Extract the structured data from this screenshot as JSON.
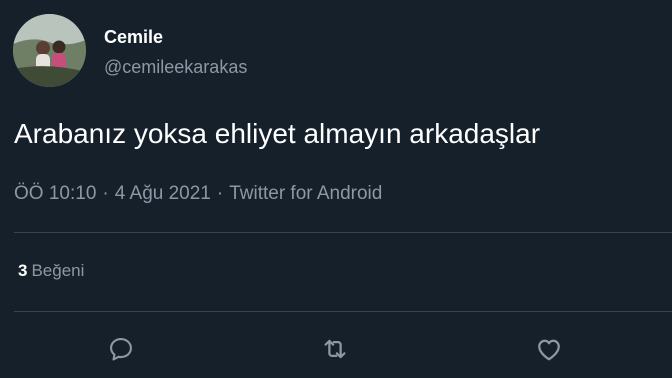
{
  "user": {
    "display_name": "Cemile",
    "handle": "@cemileekarakas"
  },
  "tweet": {
    "text": "Arabanız yoksa ehliyet almayın arkadaşlar",
    "time": "ÖÖ 10:10",
    "date": "4 Ağu 2021",
    "source": "Twitter for Android",
    "separator": "·"
  },
  "stats": {
    "likes_count": "3",
    "likes_label": "Beğeni"
  },
  "actions": [
    {
      "name": "reply",
      "icon": "reply-icon"
    },
    {
      "name": "retweet",
      "icon": "retweet-icon"
    },
    {
      "name": "like",
      "icon": "heart-icon"
    }
  ],
  "colors": {
    "background": "#15202b",
    "text": "#ffffff",
    "secondary": "#8b98a5",
    "divider": "#38444d"
  }
}
